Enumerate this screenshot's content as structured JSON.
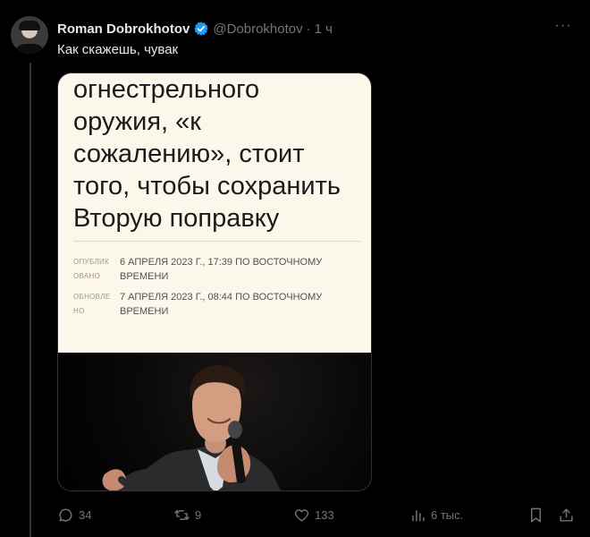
{
  "tweet": {
    "display_name": "Roman Dobrokhotov",
    "handle": "@Dobrokhotov",
    "separator": "·",
    "time": "1 ч",
    "text": "Как скажешь, чувак",
    "more_label": "···"
  },
  "article": {
    "headline_lines": [
      "огнестрельного",
      "оружия, «к",
      "сожалению», стоит",
      "того, чтобы сохранить",
      "Вторую поправку"
    ],
    "meta": [
      {
        "label_lines": [
          "ОПУБЛИК",
          "ОВАНО"
        ],
        "value_lines": [
          "6 АПРЕЛЯ 2023 Г., 17:39 ПО ВОСТОЧНОМУ",
          "ВРЕМЕНИ"
        ]
      },
      {
        "label_lines": [
          "ОБНОВЛЕ",
          "НО"
        ],
        "value_lines": [
          "7 АПРЕЛЯ 2023 Г., 08:44 ПО ВОСТОЧНОМУ",
          "ВРЕМЕНИ"
        ]
      }
    ]
  },
  "actions": {
    "replies": "34",
    "reposts": "9",
    "likes": "133",
    "views": "6 тыс."
  },
  "icons": {
    "verified": "verified-badge-icon",
    "reply": "reply-icon",
    "repost": "repost-icon",
    "like": "heart-icon",
    "views": "views-chart-icon",
    "bookmark": "bookmark-icon",
    "share": "share-icon"
  },
  "colors": {
    "background": "#000000",
    "text": "#e7e9ea",
    "muted": "#71767b",
    "verified": "#1d9bf0",
    "article_bg": "#fbf7ea"
  }
}
